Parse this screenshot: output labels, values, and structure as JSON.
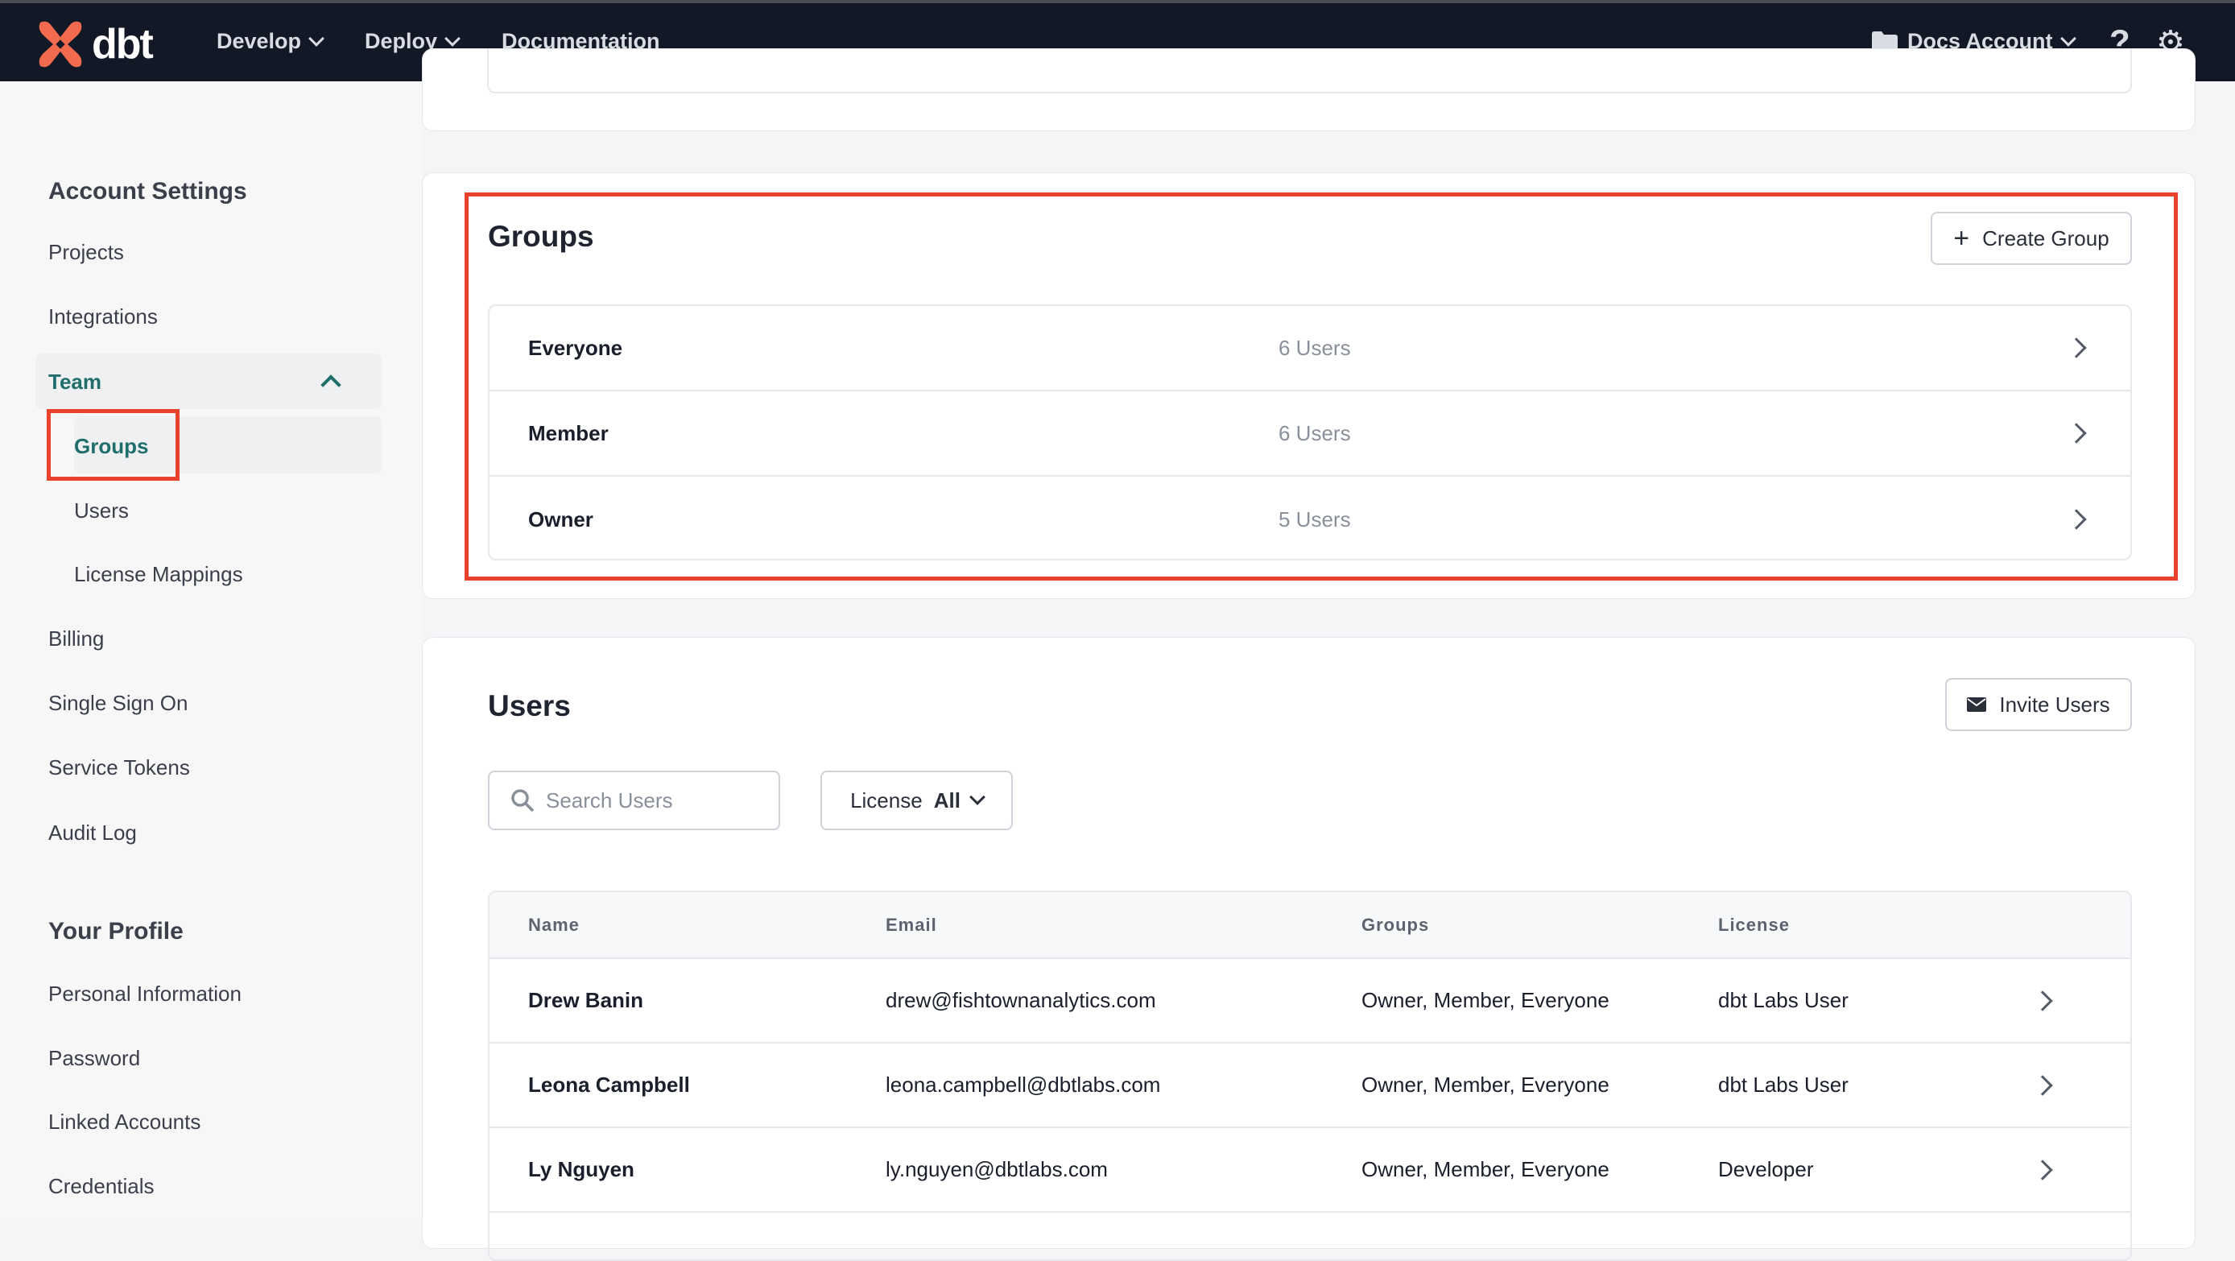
{
  "nav": {
    "logo_text": "dbt",
    "develop": "Develop",
    "deploy": "Deploy",
    "documentation": "Documentation",
    "account": "Docs Account"
  },
  "sidebar": {
    "account_settings": "Account Settings",
    "items": [
      "Projects",
      "Integrations",
      "Team",
      "Groups",
      "Users",
      "License Mappings",
      "Billing",
      "Single Sign On",
      "Service Tokens",
      "Audit Log"
    ],
    "your_profile": "Your Profile",
    "profile_items": [
      "Personal Information",
      "Password",
      "Linked Accounts",
      "Credentials"
    ]
  },
  "groups": {
    "title": "Groups",
    "create_label": "Create Group",
    "rows": [
      {
        "name": "Everyone",
        "count": "6 Users"
      },
      {
        "name": "Member",
        "count": "6 Users"
      },
      {
        "name": "Owner",
        "count": "5 Users"
      }
    ]
  },
  "users": {
    "title": "Users",
    "invite_label": "Invite Users",
    "search_placeholder": "Search Users",
    "license_label": "License",
    "license_value": "All",
    "columns": [
      "Name",
      "Email",
      "Groups",
      "License"
    ],
    "rows": [
      {
        "name": "Drew Banin",
        "email": "drew@fishtownanalytics.com",
        "groups": "Owner, Member, Everyone",
        "license": "dbt Labs User"
      },
      {
        "name": "Leona Campbell",
        "email": "leona.campbell@dbtlabs.com",
        "groups": "Owner, Member, Everyone",
        "license": "dbt Labs User"
      },
      {
        "name": "Ly Nguyen",
        "email": "ly.nguyen@dbtlabs.com",
        "groups": "Owner, Member, Everyone",
        "license": "Developer"
      }
    ]
  },
  "colors": {
    "accent": "#1f6e6b",
    "highlight": "#e8412c",
    "brand": "#f26b4f",
    "nav_bg": "#131826"
  }
}
